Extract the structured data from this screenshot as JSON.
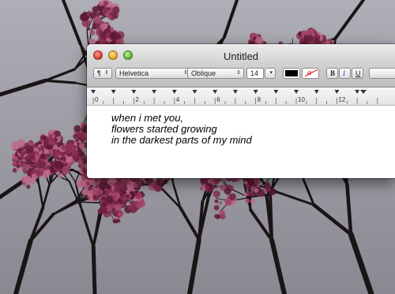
{
  "window": {
    "title": "Untitled"
  },
  "toolbar": {
    "paragraph_label": "¶",
    "font_family": "Helvetica",
    "font_style": "Oblique",
    "font_size": "14",
    "bold_label": "B",
    "italic_label": "I",
    "underline_label": "U",
    "highlight_label": "a",
    "chevron_icon": "updown-chevron-icon",
    "text_color": "#000000"
  },
  "ruler": {
    "labels": [
      "0",
      "2",
      "4",
      "6",
      "8",
      "10",
      "12"
    ]
  },
  "document": {
    "lines": [
      "when i met you,",
      "flowers started growing",
      "in the darkest parts of my mind"
    ]
  },
  "colors": {
    "blossom": "#8a2e52",
    "sky": "#9a9aa2",
    "branch": "#1b1416"
  }
}
